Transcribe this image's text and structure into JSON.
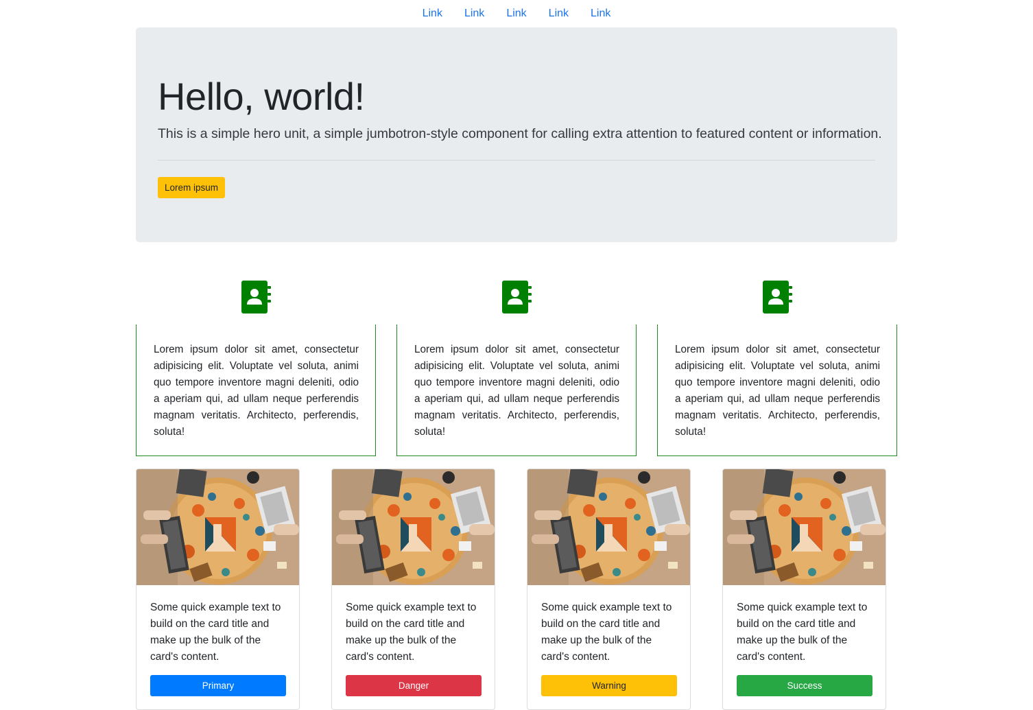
{
  "nav": {
    "links": [
      "Link",
      "Link",
      "Link",
      "Link",
      "Link"
    ]
  },
  "jumbotron": {
    "title": "Hello, world!",
    "lead": "This is a simple hero unit, a simple jumbotron-style component for calling extra attention to featured content or information.",
    "button_label": "Lorem ipsum"
  },
  "features": [
    {
      "icon": "contact-book-icon",
      "text": "Lorem ipsum dolor sit amet, consectetur adipisicing elit. Voluptate vel soluta, animi quo tempore inventore magni deleniti, odio a aperiam qui, ad ullam neque perferendis magnam veritatis. Architecto, perferendis, soluta!"
    },
    {
      "icon": "contact-book-icon",
      "text": "Lorem ipsum dolor sit amet, consectetur adipisicing elit. Voluptate vel soluta, animi quo tempore inventore magni deleniti, odio a aperiam qui, ad ullam neque perferendis magnam veritatis. Architecto, perferendis, soluta!"
    },
    {
      "icon": "contact-book-icon",
      "text": "Lorem ipsum dolor sit amet, consectetur adipisicing elit. Voluptate vel soluta, animi quo tempore inventore magni deleniti, odio a aperiam qui, ad ullam neque perferendis magnam veritatis. Architecto, perferendis, soluta!"
    }
  ],
  "cards": [
    {
      "text": "Some quick example text to build on the card title and make up the bulk of the card's content.",
      "button_label": "Primary",
      "button_color": "#007bff",
      "button_text_color": "#ffffff"
    },
    {
      "text": "Some quick example text to build on the card title and make up the bulk of the card's content.",
      "button_label": "Danger",
      "button_color": "#dc3545",
      "button_text_color": "#ffffff"
    },
    {
      "text": "Some quick example text to build on the card title and make up the bulk of the card's content.",
      "button_label": "Warning",
      "button_color": "#ffc107",
      "button_text_color": "#212529"
    },
    {
      "text": "Some quick example text to build on the card title and make up the bulk of the card's content.",
      "button_label": "Success",
      "button_color": "#28a745",
      "button_text_color": "#ffffff"
    }
  ],
  "colors": {
    "link": "#1a73e8",
    "jumbotron_bg": "#e9ecef",
    "feature_border": "#1f8a1f",
    "icon": "#008000"
  }
}
